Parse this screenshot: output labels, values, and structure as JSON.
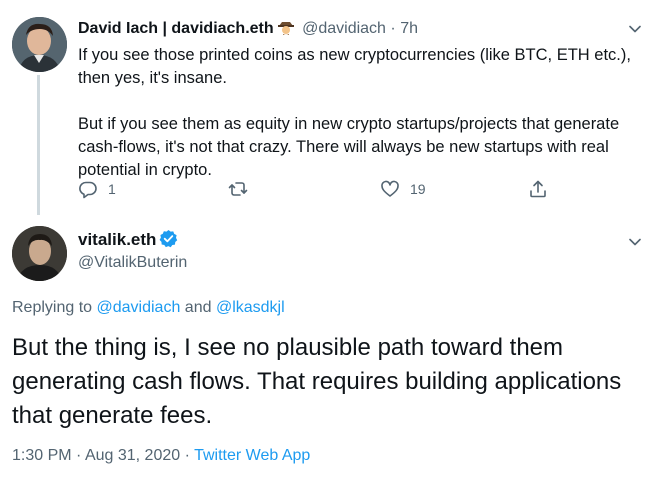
{
  "tweet1": {
    "display_name": "David Iach | davidiach.eth",
    "badge_icon": "detective-emoji",
    "handle": "@davidiach",
    "separator": "·",
    "time": "7h",
    "body_p1": "If you see those printed coins as new cryptocurrencies (like BTC, ETH etc.), then yes, it's insane.",
    "body_p2": "But if you see them as equity in new crypto startups/projects that generate cash-flows, it's not that crazy. There will always be new startups with real potential in crypto.",
    "actions": {
      "reply_count": "1",
      "retweet_count": "",
      "like_count": "19"
    }
  },
  "tweet2": {
    "display_name": "vitalik.eth",
    "handle": "@VitalikButerin",
    "replying_prefix": "Replying to",
    "mention1": "@davidiach",
    "and_word": "and",
    "mention2": "@lkasdkjl",
    "body": "But the thing is, I see no plausible path toward them generating cash flows. That requires building applications that generate fees.",
    "time": "1:30 PM",
    "dot1": "·",
    "date": "Aug 31, 2020",
    "dot2": "·",
    "source": "Twitter Web App"
  },
  "colors": {
    "link": "#1d9bf0",
    "secondary": "#536471",
    "verified": "#1d9bf0"
  }
}
